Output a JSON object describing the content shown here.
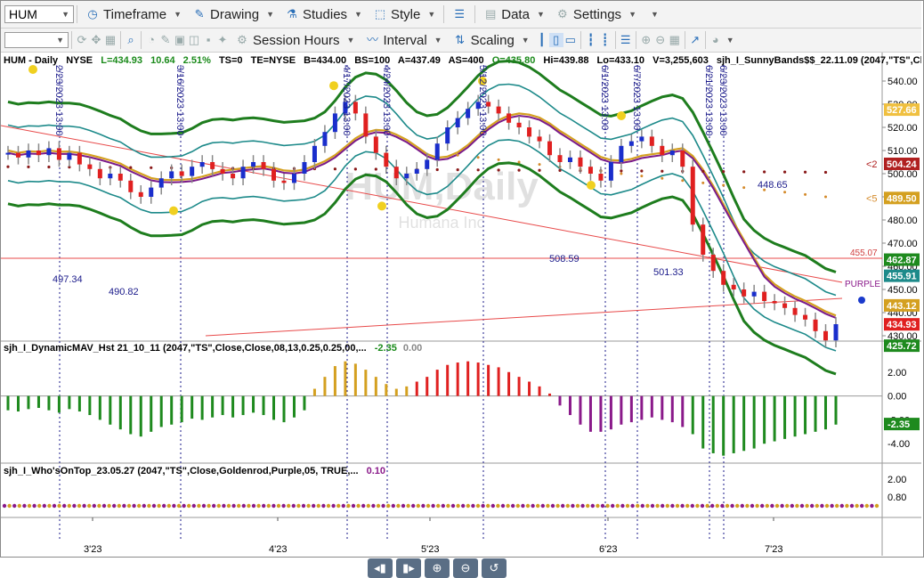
{
  "toolbar": {
    "symbol": "HUM",
    "timeframe": "Timeframe",
    "drawing": "Drawing",
    "studies": "Studies",
    "style": "Style",
    "data": "Data",
    "settings": "Settings",
    "session_hours": "Session Hours",
    "interval": "Interval",
    "scaling": "Scaling"
  },
  "header": {
    "symbol": "HUM - Daily",
    "exchange": "NYSE",
    "last": "L=434.93",
    "change": "10.64",
    "pct": "2.51%",
    "ts": "TS=0",
    "te": "TE=NYSE",
    "b": "B=434.00",
    "bs": "BS=100",
    "a": "A=437.49",
    "as": "AS=400",
    "o": "O=435.80",
    "hi": "Hi=439.88",
    "lo": "Lo=433.10",
    "v": "V=3,255,603",
    "study": "sjh_I_SunnyBands$$_22.11.09 (2047,\"TS\",Clos..."
  },
  "watermark": {
    "title": "HUM,Daily",
    "subtitle": "Humana Inc"
  },
  "date_labels": [
    "2/23/2023 13:00",
    "3/16/2023 13:00",
    "4/17/2023 13:00",
    "4/24/2023 13:00",
    "5/12/2023 13:00",
    "6/1/2023 13:00",
    "6/7/2023 13:00",
    "6/21/2023 13:00",
    "6/23/2023 13:00"
  ],
  "annotations": [
    "497.34",
    "490.82",
    "508.59",
    "501.33",
    "448.65",
    "455.07",
    "PURPLE"
  ],
  "price_axis": [
    "540.00",
    "530.00",
    "520.00",
    "510.00",
    "500.00",
    "490.00",
    "480.00",
    "470.00",
    "460.00",
    "450.00",
    "440.00",
    "430.00"
  ],
  "price_tags": [
    "527.66",
    "504.24",
    "489.50",
    "462.87",
    "455.91",
    "443.12",
    "434.93",
    "425.72",
    "<2",
    "<5"
  ],
  "indicator1": {
    "title": "sjh_I_DynamicMAV_Hst 21_10_11 (2047,\"TS\",Close,Close,08,13,0.25,0.25,00,...",
    "v1": "-2.35",
    "v2": "0.00",
    "axis": [
      "2.00",
      "0.00",
      "-2.00",
      "-4.00"
    ],
    "tag": "-2.35"
  },
  "indicator2": {
    "title": "sjh_I_Who'sOnTop_23.05.27 (2047,\"TS\",Close,Goldenrod,Purple,05,  TRUE,...",
    "v1": "0.10",
    "axis": [
      "2.00",
      "0.80"
    ]
  },
  "x_axis": [
    "3'23",
    "4'23",
    "5'23",
    "6'23",
    "7'23"
  ],
  "chart_data": {
    "type": "candlestick",
    "ylim": [
      422,
      546
    ],
    "colors": {
      "up": "#1a2ecc",
      "down": "#e02020",
      "band": "#1e7d1e",
      "inner": "#1d8a8a",
      "ma_gold": "#d4a020",
      "ma_purple": "#7a1a8a"
    },
    "close": [
      509,
      507,
      510,
      508,
      511,
      506,
      509,
      504,
      502,
      498,
      500,
      497,
      492,
      490,
      494,
      498,
      501,
      499,
      503,
      505,
      502,
      500,
      498,
      503,
      505,
      502,
      497,
      496,
      500,
      505,
      512,
      518,
      526,
      531,
      526,
      516,
      509,
      503,
      498,
      500,
      502,
      506,
      513,
      520,
      524,
      528,
      531,
      529,
      526,
      522,
      520,
      516,
      514,
      508,
      505,
      507,
      503,
      500,
      497,
      505,
      512,
      514,
      516,
      512,
      508,
      510,
      503,
      478,
      465,
      458,
      452,
      450,
      447,
      449,
      445,
      444,
      442,
      439,
      437,
      432,
      428,
      435
    ],
    "hist": [
      -1.2,
      -1.3,
      -1.1,
      -1.0,
      -1.2,
      -1.4,
      -1.1,
      -1.3,
      -1.6,
      -2.0,
      -2.4,
      -2.8,
      -3.2,
      -3.4,
      -3.0,
      -2.6,
      -2.4,
      -2.2,
      -1.9,
      -2.0,
      -1.8,
      -1.6,
      -1.8,
      -1.6,
      -1.4,
      -1.6,
      -2.0,
      -2.2,
      -1.8,
      -1.2,
      0.6,
      1.6,
      2.5,
      2.9,
      2.7,
      2.2,
      1.6,
      1.0,
      0.6,
      0.8,
      1.2,
      1.6,
      2.2,
      2.6,
      2.8,
      2.9,
      2.8,
      2.6,
      2.4,
      2.0,
      1.6,
      1.2,
      0.8,
      0.2,
      -0.8,
      -1.6,
      -2.4,
      -3.0,
      -3.0,
      -2.8,
      -2.4,
      -2.2,
      -2.0,
      -1.8,
      -2.0,
      -2.2,
      -2.6,
      -3.2,
      -4.4,
      -4.8,
      -5.0,
      -4.8,
      -4.6,
      -4.4,
      -4.0,
      -3.8,
      -3.6,
      -3.4,
      -3.2,
      -3.0,
      -2.8,
      -2.4
    ],
    "hist_colors": [
      "#1e8a1e",
      "#d4a020",
      "#e02020",
      "#8a1a8a"
    ]
  }
}
